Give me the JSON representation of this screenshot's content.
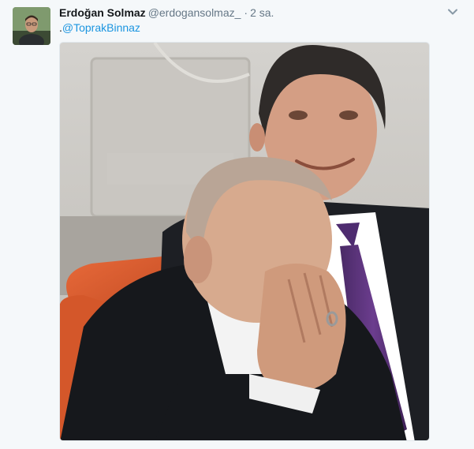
{
  "author": {
    "name": "Erdoğan Solmaz",
    "handle": "@erdogansolmaz_",
    "separator": "·",
    "time": "2 sa."
  },
  "tweet": {
    "prefix": ".",
    "mention": "@ToprakBinnaz"
  },
  "icons": {
    "menu": "chevron-down-icon"
  },
  "colors": {
    "background": "#f5f8fa",
    "name": "#14171a",
    "secondary": "#657786",
    "link": "#1b95e0"
  }
}
